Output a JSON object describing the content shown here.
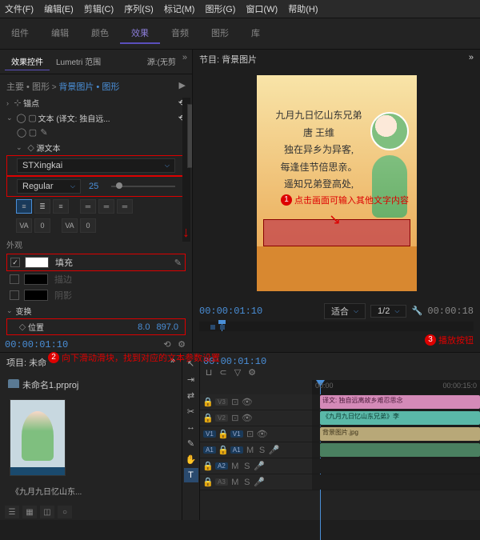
{
  "menu": [
    "文件(F)",
    "编辑(E)",
    "剪辑(C)",
    "序列(S)",
    "标记(M)",
    "图形(G)",
    "窗口(W)",
    "帮助(H)"
  ],
  "tabs": {
    "items": [
      "组件",
      "编辑",
      "颜色",
      "效果",
      "音频",
      "图形",
      "库"
    ],
    "active": 3
  },
  "effects_panel": {
    "tabs": [
      "效果控件",
      "Lumetri 范围"
    ],
    "tabs_active": 0,
    "source_label": "源:(无剪",
    "breadcrumb": {
      "a": "主要 • 图形",
      "b": "背景图片 • 图形"
    },
    "anchor": "锚点",
    "text_fx": "文本 (译文: 独自远...",
    "source_text": "源文本",
    "font": "STXingkai",
    "weight": "Regular",
    "size": "25",
    "align_icons": [
      "≡",
      "≣",
      "≡",
      "═",
      "═",
      "═"
    ],
    "kern_icons": [
      "VA",
      "0",
      "VA",
      "0"
    ],
    "appearance": "外观",
    "fill": "填充",
    "stroke_label": "描边",
    "shadow_label": "阴影",
    "transform": "变换",
    "position": "位置",
    "pos_x": "8.0",
    "pos_y": "897.0"
  },
  "program_panel": {
    "title": "节目: 背景图片",
    "poem": "九月九日忆山东兄弟\n        唐 王维\n独在异乡为异客,\n每逢佳节倍思亲。\n遥知兄弟登高处,",
    "timecode": "00:00:01:10",
    "fit": "适合",
    "zoom": "1/2",
    "timecode_right": "00:00:18"
  },
  "annotations": {
    "a1": "点击画面可输入其他文字内容",
    "a2": "向下滑动滑块，找到对应的文本参数设置",
    "a3": "播放按钮"
  },
  "project": {
    "title": "项目: 未命",
    "file": "未命名1.prproj",
    "clip_name": "《九月九日忆山东..."
  },
  "timeline": {
    "timecode": "00:00:01:10",
    "tick1": "00:00",
    "tick2": "00:00:15:0",
    "tracks": {
      "v3": "V3",
      "v2": "V2",
      "v1": "V1",
      "a1": "A1",
      "a2": "A2",
      "a3": "A3"
    },
    "clips": {
      "subtitle": "译文: 独自远离故乡难忍思念",
      "title_clip": "《九月九日忆山东兄弟》李",
      "bg": "背景图片.jpg"
    }
  },
  "left_tc": "00:00:01:10"
}
